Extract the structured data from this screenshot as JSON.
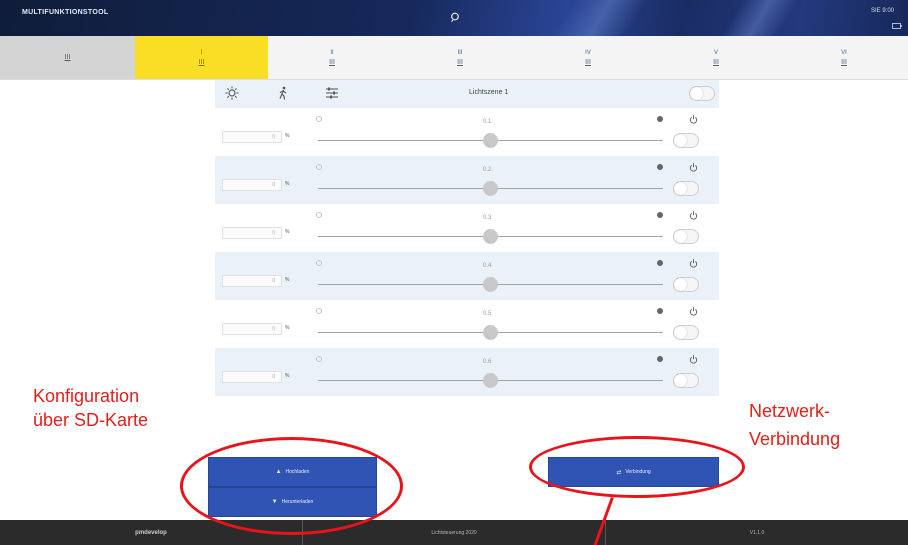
{
  "header": {
    "app_title": "MULTIFUNKTIONSTOOL",
    "status_text": "SIE 9:00"
  },
  "tabs": [
    {
      "num": "",
      "icon": "III"
    },
    {
      "num": "I",
      "icon": "III"
    },
    {
      "num": "II",
      "icon": "III"
    },
    {
      "num": "III",
      "icon": "III"
    },
    {
      "num": "IV",
      "icon": "III"
    },
    {
      "num": "V",
      "icon": "III"
    },
    {
      "num": "VI",
      "icon": "III"
    }
  ],
  "panel": {
    "scene_title": "Lichtszene 1",
    "rows": [
      {
        "label": "0.1",
        "value": "0",
        "unit": "%",
        "level": 0.5
      },
      {
        "label": "0.2",
        "value": "0",
        "unit": "%",
        "level": 0.5
      },
      {
        "label": "0.3",
        "value": "0",
        "unit": "%",
        "level": 0.5
      },
      {
        "label": "0.4",
        "value": "0",
        "unit": "%",
        "level": 0.5
      },
      {
        "label": "0.5",
        "value": "0",
        "unit": "%",
        "level": 0.5
      },
      {
        "label": "0.6",
        "value": "0",
        "unit": "%",
        "level": 0.5
      }
    ]
  },
  "buttons": {
    "upload": "Hochladen",
    "download": "Herunterladen",
    "connect": "Verbindung"
  },
  "footer": {
    "logo": "pmdevelop",
    "center": "Lichtsteuerung 2020",
    "right": "V1.1.0"
  },
  "annotations": {
    "left_line1": "Konfiguration",
    "left_line2": "über SD-Karte",
    "right_line1": "Netzwerk-",
    "right_line2": "Verbindung"
  },
  "colors": {
    "accent_blue": "#2f54b3",
    "active_tab": "#fade23",
    "annotation_red": "#e8141a",
    "footer": "#2b2b2b"
  },
  "icons": {
    "header": "search-icon",
    "panel": [
      "sun-icon",
      "walking-person-icon",
      "sliders-icon"
    ],
    "row": "power-icon",
    "upload": "upload-icon",
    "download": "download-icon",
    "connect": "connect-icon"
  }
}
